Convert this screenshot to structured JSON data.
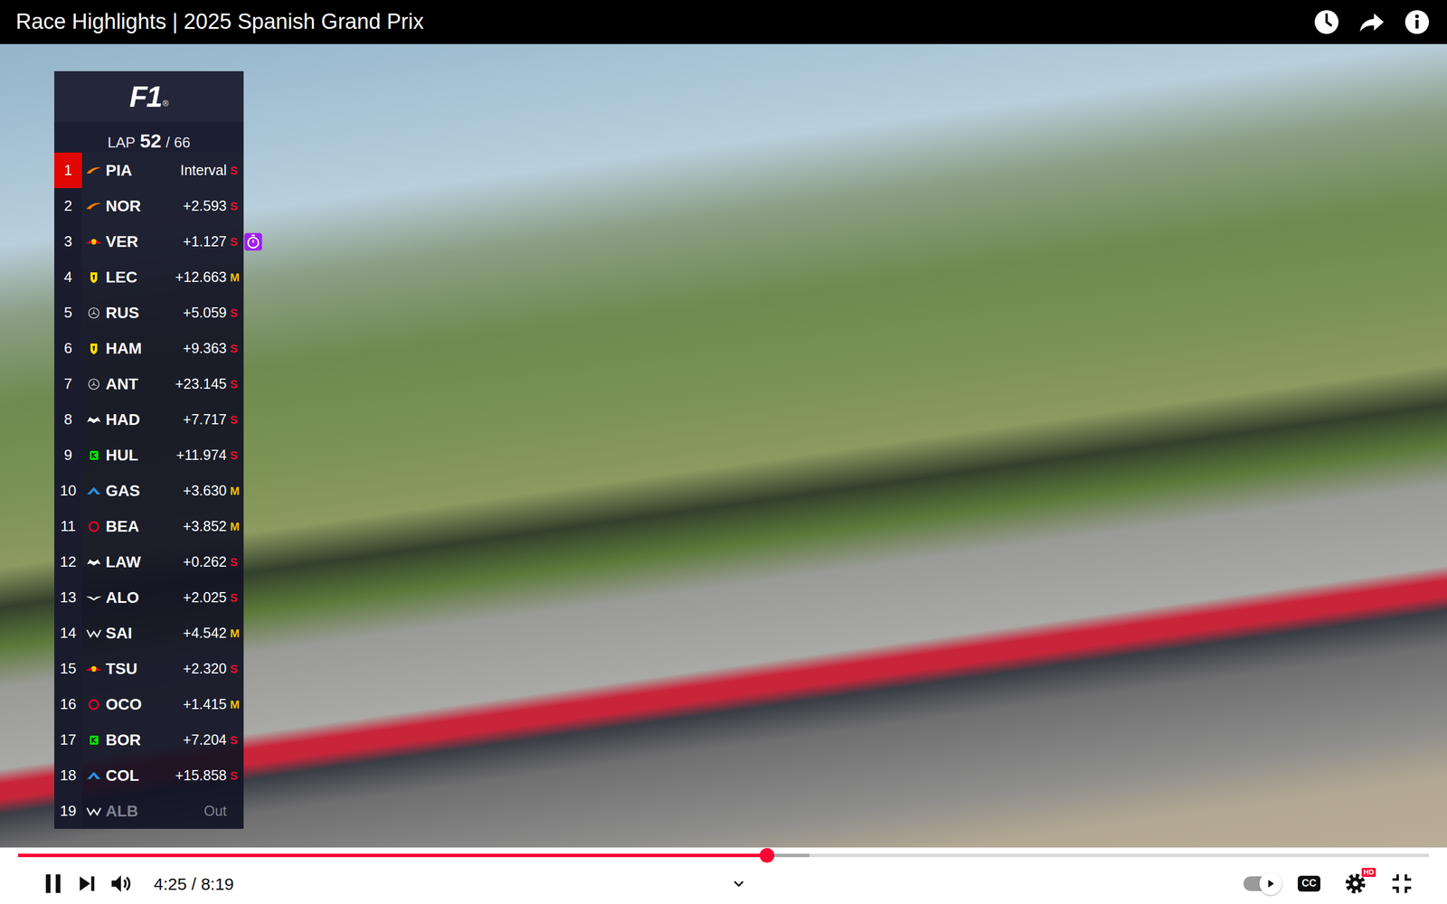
{
  "player": {
    "title": "Race Highlights | 2025 Spanish Grand Prix",
    "playing": true,
    "time": "4:25 / 8:19",
    "progress": {
      "level": 0.531,
      "buffered": 0.561
    },
    "autoplay": true,
    "cc_label": "CC",
    "quality_badge": "HD"
  },
  "tower": {
    "logo": "F1",
    "logo_mark": "®",
    "lap_label": "LAP",
    "lap": "52",
    "lap_total": "/ 66",
    "rows": [
      {
        "pos": "1",
        "driver": "PIA",
        "gap": "Interval",
        "tyre": "S",
        "color": "#e8102d",
        "kind": "mclaren",
        "selected": true,
        "fastest_lap": false,
        "retired": false
      },
      {
        "pos": "2",
        "driver": "NOR",
        "gap": "+2.593",
        "tyre": "S",
        "color": "#e8102d",
        "kind": "mclaren",
        "selected": false,
        "fastest_lap": false,
        "retired": false
      },
      {
        "pos": "3",
        "driver": "VER",
        "gap": "+1.127",
        "tyre": "S",
        "color": "#e8102d",
        "kind": "redbull",
        "selected": false,
        "fastest_lap": true,
        "retired": false
      },
      {
        "pos": "4",
        "driver": "LEC",
        "gap": "+12.663",
        "tyre": "M",
        "color": "#f5c400",
        "kind": "ferrari",
        "selected": false,
        "fastest_lap": false,
        "retired": false
      },
      {
        "pos": "5",
        "driver": "RUS",
        "gap": "+5.059",
        "tyre": "S",
        "color": "#e8102d",
        "kind": "mercedes",
        "selected": false,
        "fastest_lap": false,
        "retired": false
      },
      {
        "pos": "6",
        "driver": "HAM",
        "gap": "+9.363",
        "tyre": "S",
        "color": "#e8102d",
        "kind": "ferrari",
        "selected": false,
        "fastest_lap": false,
        "retired": false
      },
      {
        "pos": "7",
        "driver": "ANT",
        "gap": "+23.145",
        "tyre": "S",
        "color": "#e8102d",
        "kind": "mercedes",
        "selected": false,
        "fastest_lap": false,
        "retired": false
      },
      {
        "pos": "8",
        "driver": "HAD",
        "gap": "+7.717",
        "tyre": "S",
        "color": "#e8102d",
        "kind": "racingbulls",
        "selected": false,
        "fastest_lap": false,
        "retired": false
      },
      {
        "pos": "9",
        "driver": "HUL",
        "gap": "+11.974",
        "tyre": "S",
        "color": "#e8102d",
        "kind": "sauber",
        "selected": false,
        "fastest_lap": false,
        "retired": false
      },
      {
        "pos": "10",
        "driver": "GAS",
        "gap": "+3.630",
        "tyre": "M",
        "color": "#f5c400",
        "kind": "alpine",
        "selected": false,
        "fastest_lap": false,
        "retired": false
      },
      {
        "pos": "11",
        "driver": "BEA",
        "gap": "+3.852",
        "tyre": "M",
        "color": "#f5c400",
        "kind": "haas",
        "selected": false,
        "fastest_lap": false,
        "retired": false
      },
      {
        "pos": "12",
        "driver": "LAW",
        "gap": "+0.262",
        "tyre": "S",
        "color": "#e8102d",
        "kind": "racingbulls",
        "selected": false,
        "fastest_lap": false,
        "retired": false
      },
      {
        "pos": "13",
        "driver": "ALO",
        "gap": "+2.025",
        "tyre": "S",
        "color": "#e8102d",
        "kind": "astonmartin",
        "selected": false,
        "fastest_lap": false,
        "retired": false
      },
      {
        "pos": "14",
        "driver": "SAI",
        "gap": "+4.542",
        "tyre": "M",
        "color": "#f5c400",
        "kind": "williams",
        "selected": false,
        "fastest_lap": false,
        "retired": false
      },
      {
        "pos": "15",
        "driver": "TSU",
        "gap": "+2.320",
        "tyre": "S",
        "color": "#e8102d",
        "kind": "redbull",
        "selected": false,
        "fastest_lap": false,
        "retired": false
      },
      {
        "pos": "16",
        "driver": "OCO",
        "gap": "+1.415",
        "tyre": "M",
        "color": "#f5c400",
        "kind": "haas",
        "selected": false,
        "fastest_lap": false,
        "retired": false
      },
      {
        "pos": "17",
        "driver": "BOR",
        "gap": "+7.204",
        "tyre": "S",
        "color": "#e8102d",
        "kind": "sauber",
        "selected": false,
        "fastest_lap": false,
        "retired": false
      },
      {
        "pos": "18",
        "driver": "COL",
        "gap": "+15.858",
        "tyre": "S",
        "color": "#e8102d",
        "kind": "alpine",
        "selected": false,
        "fastest_lap": false,
        "retired": false
      },
      {
        "pos": "19",
        "driver": "ALB",
        "gap": "Out",
        "kind": "williams",
        "selected": false,
        "fastest_lap": false,
        "retired": true
      }
    ]
  }
}
